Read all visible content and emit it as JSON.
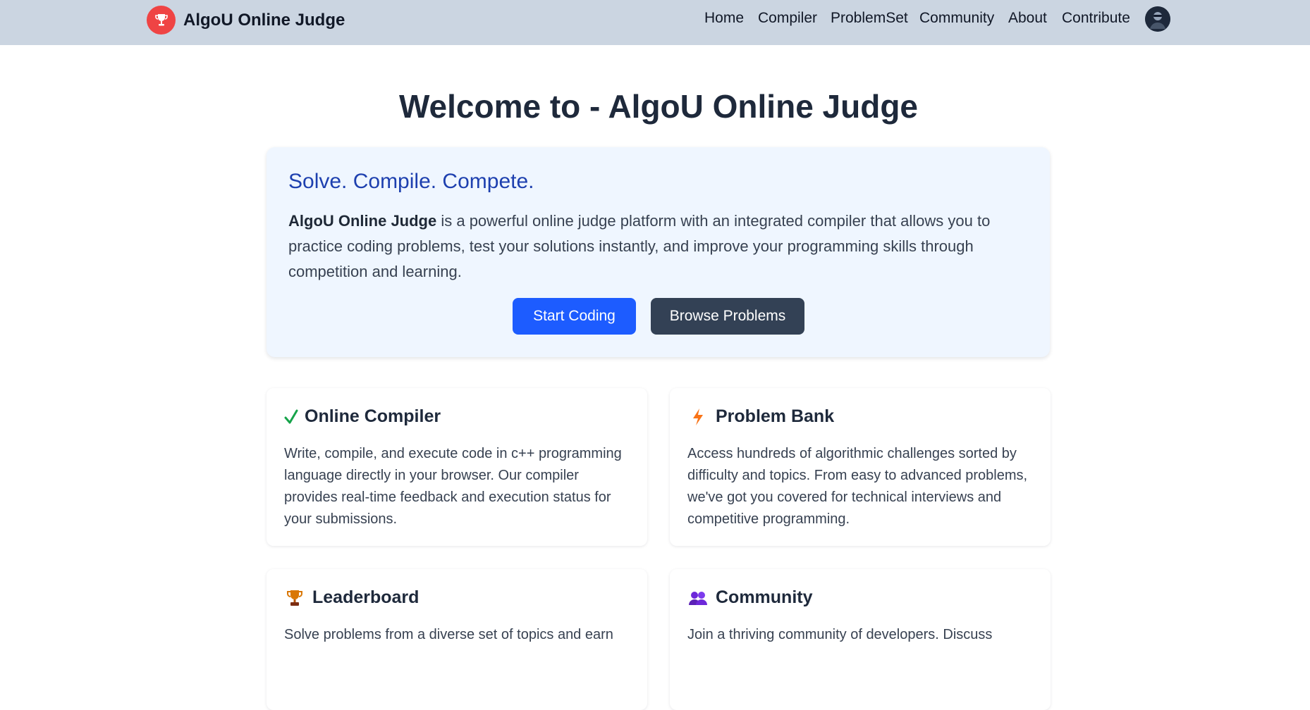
{
  "navbar": {
    "brand": "AlgoU Online Judge",
    "links": [
      "Home",
      "Compiler",
      "ProblemSet",
      "Community",
      "About",
      "Contribute"
    ]
  },
  "page_title": "Welcome to - AlgoU Online Judge",
  "hero": {
    "tagline": "Solve. Compile. Compete.",
    "desc_bold": "AlgoU Online Judge",
    "desc_rest": " is a powerful online judge platform with an integrated compiler that allows you to practice coding problems, test your solutions instantly, and improve your programming skills through competition and learning.",
    "primary_button": "Start Coding",
    "secondary_button": "Browse Problems"
  },
  "features": [
    {
      "icon": "checkmark-icon",
      "title": "Online Compiler",
      "text": "Write, compile, and execute code in c++ programming language directly in your browser. Our compiler provides real-time feedback and execution status for your submissions."
    },
    {
      "icon": "lightning-icon",
      "title": "Problem Bank",
      "text": "Access hundreds of algorithmic challenges sorted by difficulty and topics. From easy to advanced problems, we've got you covered for technical interviews and competitive programming."
    },
    {
      "icon": "trophy-icon",
      "title": "Leaderboard",
      "text": "Solve problems from a diverse set of topics and earn"
    },
    {
      "icon": "people-icon",
      "title": "Community",
      "text": "Join a thriving community of developers. Discuss"
    }
  ],
  "colors": {
    "navbar_bg": "#cbd5e1",
    "brand_logo": "#ef4444",
    "primary": "#1d5cff",
    "dark_button": "#334155",
    "tagline": "#1e40af",
    "hero_bg": "#eff6ff"
  }
}
